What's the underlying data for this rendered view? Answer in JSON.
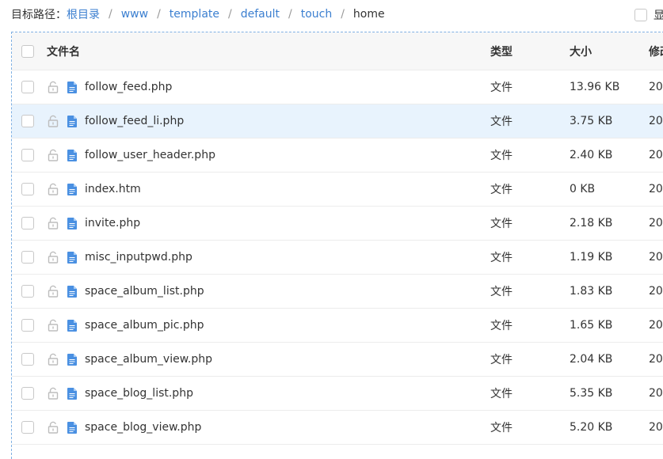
{
  "breadcrumb": {
    "label": "目标路径：",
    "segments": [
      "根目录",
      "www",
      "template",
      "default",
      "touch",
      "home"
    ],
    "separator": "/"
  },
  "toggle": {
    "label": "显"
  },
  "table": {
    "headers": {
      "name": "文件名",
      "type": "类型",
      "size": "大小",
      "date": "修改"
    },
    "rows": [
      {
        "name": "follow_feed.php",
        "type": "文件",
        "size": "13.96 KB",
        "date": "20"
      },
      {
        "name": "follow_feed_li.php",
        "type": "文件",
        "size": "3.75 KB",
        "date": "20"
      },
      {
        "name": "follow_user_header.php",
        "type": "文件",
        "size": "2.40 KB",
        "date": "20"
      },
      {
        "name": "index.htm",
        "type": "文件",
        "size": "0 KB",
        "date": "20"
      },
      {
        "name": "invite.php",
        "type": "文件",
        "size": "2.18 KB",
        "date": "20"
      },
      {
        "name": "misc_inputpwd.php",
        "type": "文件",
        "size": "1.19 KB",
        "date": "20"
      },
      {
        "name": "space_album_list.php",
        "type": "文件",
        "size": "1.83 KB",
        "date": "20"
      },
      {
        "name": "space_album_pic.php",
        "type": "文件",
        "size": "1.65 KB",
        "date": "20"
      },
      {
        "name": "space_album_view.php",
        "type": "文件",
        "size": "2.04 KB",
        "date": "20"
      },
      {
        "name": "space_blog_list.php",
        "type": "文件",
        "size": "5.35 KB",
        "date": "20"
      },
      {
        "name": "space_blog_view.php",
        "type": "文件",
        "size": "5.20 KB",
        "date": "20"
      }
    ]
  },
  "icons": {
    "lock": "lock-open-icon",
    "file": "file-icon"
  },
  "colors": {
    "link": "#3b7fd0",
    "row_highlight": "#e8f3fd",
    "file_icon": "#4a90e2",
    "panel_border": "#7fb0e3"
  }
}
